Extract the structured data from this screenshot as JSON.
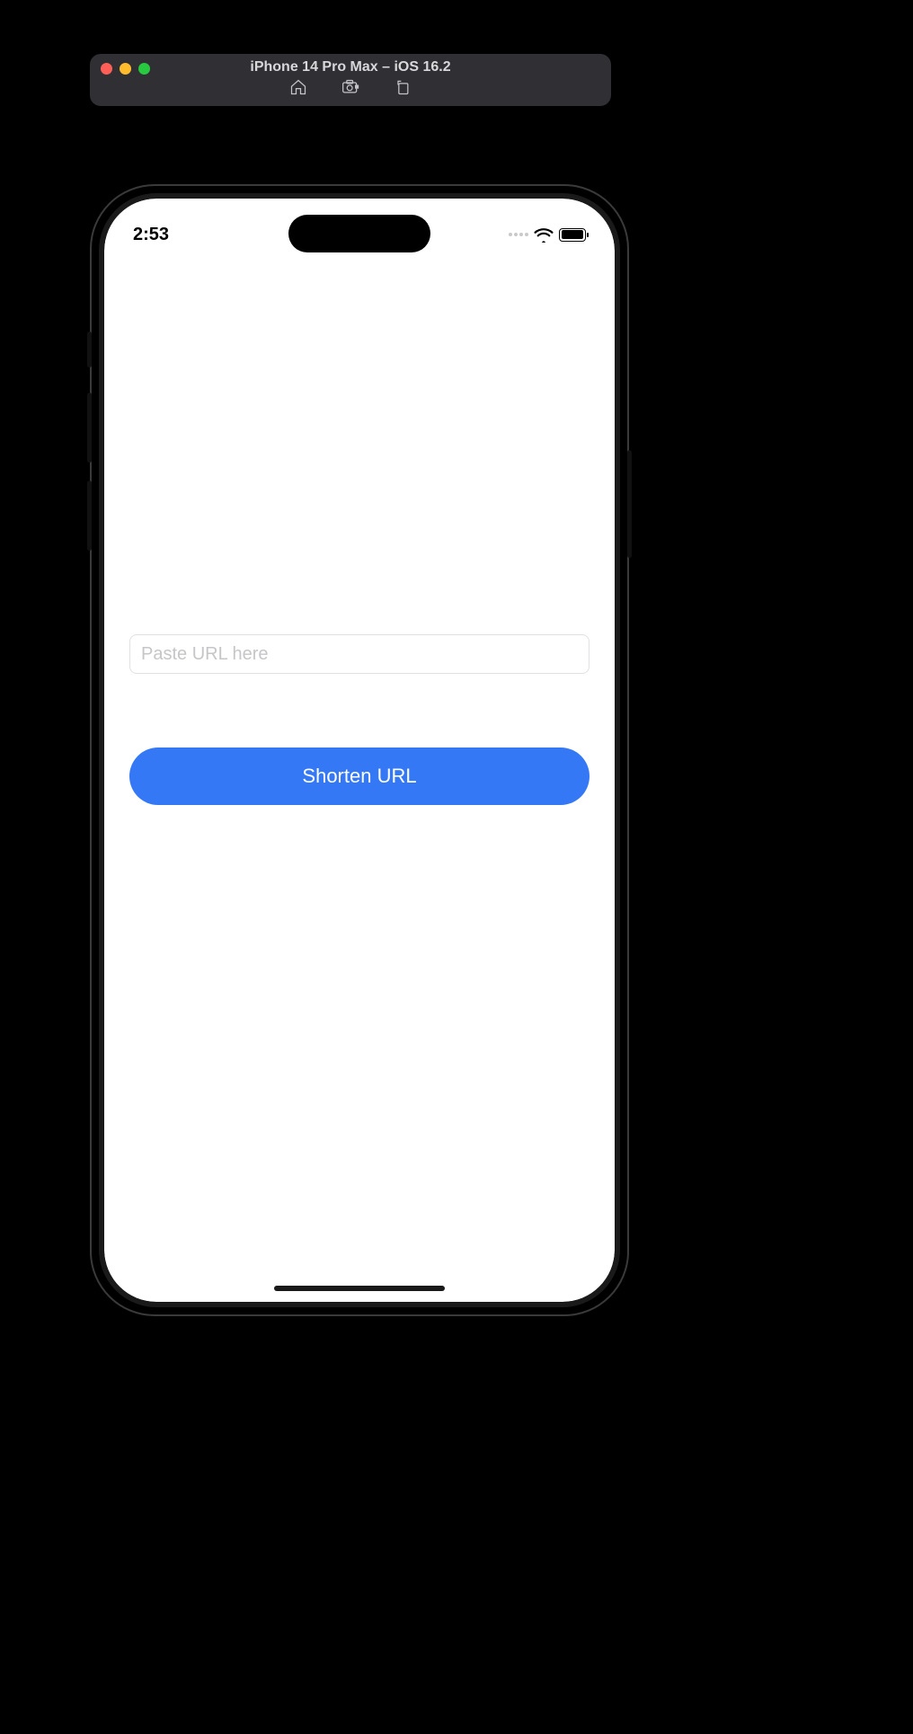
{
  "simulator": {
    "window_title": "iPhone 14 Pro Max – iOS 16.2",
    "toolbar_icons": {
      "home": "home-icon",
      "screenshot": "screenshot-icon",
      "rotate": "rotate-icon"
    }
  },
  "status_bar": {
    "time": "2:53"
  },
  "app": {
    "url_input": {
      "placeholder": "Paste URL here",
      "value": ""
    },
    "shorten_button_label": "Shorten URL"
  }
}
